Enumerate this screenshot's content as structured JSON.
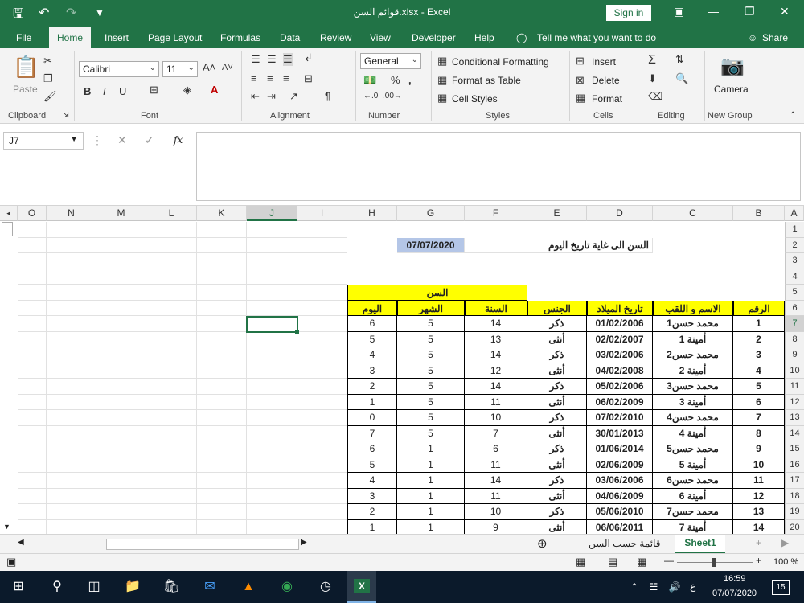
{
  "titlebar": {
    "title": "قوائم السن.xlsx - Excel",
    "sign_in": "Sign in"
  },
  "tabs": [
    "File",
    "Home",
    "Insert",
    "Page Layout",
    "Formulas",
    "Data",
    "Review",
    "View",
    "Developer",
    "Help"
  ],
  "tell_me": "Tell me what you want to do",
  "share": "Share",
  "ribbon": {
    "paste": "Paste",
    "font_name": "Calibri",
    "font_size": "11",
    "number_format": "General",
    "conditional_formatting": "Conditional Formatting",
    "format_as_table": "Format as Table",
    "cell_styles": "Cell Styles",
    "insert": "Insert",
    "delete": "Delete",
    "format": "Format",
    "camera": "Camera",
    "groups": {
      "clipboard": "Clipboard",
      "font": "Font",
      "alignment": "Alignment",
      "number": "Number",
      "styles": "Styles",
      "cells": "Cells",
      "editing": "Editing",
      "new_group": "New Group"
    }
  },
  "formula_bar": {
    "name_box": "J7",
    "fx": "fx"
  },
  "columns": [
    "O",
    "N",
    "M",
    "L",
    "K",
    "J",
    "I",
    "H",
    "G",
    "F",
    "E",
    "D",
    "C",
    "B",
    "A"
  ],
  "rows": [
    "1",
    "2",
    "3",
    "4",
    "5",
    "6",
    "7",
    "8",
    "9",
    "10",
    "11",
    "12",
    "13",
    "14",
    "15",
    "16",
    "17",
    "18",
    "19",
    "20"
  ],
  "sheet": {
    "title_label": "السن الى غاية تاريخ اليوم",
    "today": "07/07/2020",
    "age_header": "السن",
    "headers": {
      "num": "الرقم",
      "name": "الاسم و اللقب",
      "birth": "تاريخ الميلاد",
      "gender": "الجنس",
      "year": "السنة",
      "month": "الشهر",
      "day": "اليوم"
    },
    "data": [
      {
        "num": "1",
        "name": "محمد حسن1",
        "birth": "01/02/2006",
        "gender": "ذكر",
        "year": "14",
        "month": "5",
        "day": "6"
      },
      {
        "num": "2",
        "name": "أمينة 1",
        "birth": "02/02/2007",
        "gender": "أنثى",
        "year": "13",
        "month": "5",
        "day": "5"
      },
      {
        "num": "3",
        "name": "محمد حسن2",
        "birth": "03/02/2006",
        "gender": "ذكر",
        "year": "14",
        "month": "5",
        "day": "4"
      },
      {
        "num": "4",
        "name": "أمينة 2",
        "birth": "04/02/2008",
        "gender": "أنثى",
        "year": "12",
        "month": "5",
        "day": "3"
      },
      {
        "num": "5",
        "name": "محمد حسن3",
        "birth": "05/02/2006",
        "gender": "ذكر",
        "year": "14",
        "month": "5",
        "day": "2"
      },
      {
        "num": "6",
        "name": "أمينة 3",
        "birth": "06/02/2009",
        "gender": "أنثى",
        "year": "11",
        "month": "5",
        "day": "1"
      },
      {
        "num": "7",
        "name": "محمد حسن4",
        "birth": "07/02/2010",
        "gender": "ذكر",
        "year": "10",
        "month": "5",
        "day": "0"
      },
      {
        "num": "8",
        "name": "أمينة 4",
        "birth": "30/01/2013",
        "gender": "أنثى",
        "year": "7",
        "month": "5",
        "day": "7"
      },
      {
        "num": "9",
        "name": "محمد حسن5",
        "birth": "01/06/2014",
        "gender": "ذكر",
        "year": "6",
        "month": "1",
        "day": "6"
      },
      {
        "num": "10",
        "name": "أمينة 5",
        "birth": "02/06/2009",
        "gender": "أنثى",
        "year": "11",
        "month": "1",
        "day": "5"
      },
      {
        "num": "11",
        "name": "محمد حسن6",
        "birth": "03/06/2006",
        "gender": "ذكر",
        "year": "14",
        "month": "1",
        "day": "4"
      },
      {
        "num": "12",
        "name": "أمينة 6",
        "birth": "04/06/2009",
        "gender": "أنثى",
        "year": "11",
        "month": "1",
        "day": "3"
      },
      {
        "num": "13",
        "name": "محمد حسن7",
        "birth": "05/06/2010",
        "gender": "ذكر",
        "year": "10",
        "month": "1",
        "day": "2"
      },
      {
        "num": "14",
        "name": "أمينة 7",
        "birth": "06/06/2011",
        "gender": "أنثى",
        "year": "9",
        "month": "1",
        "day": "1"
      }
    ]
  },
  "sheet_tabs": {
    "active": "Sheet1",
    "other": "قائمة حسب السن"
  },
  "status": {
    "zoom": "100 %"
  },
  "taskbar": {
    "time": "16:59",
    "date": "07/07/2020",
    "lang": "ع",
    "notifications": "15"
  },
  "colors": {
    "excel_green": "#217346",
    "header_yellow": "#ffff00",
    "date_highlight": "#b4c6e7"
  }
}
